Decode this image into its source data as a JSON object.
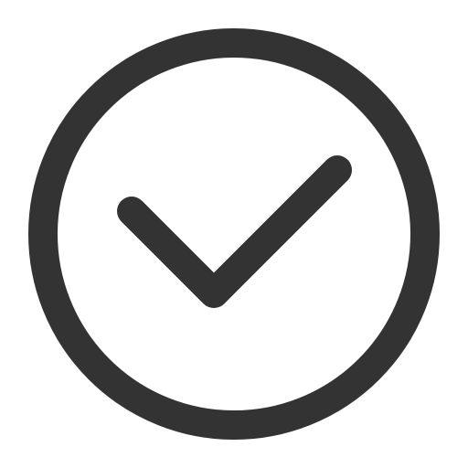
{
  "icon": {
    "name": "check-circle-icon",
    "stroke_color": "#333333",
    "background_color": "#ffffff"
  }
}
